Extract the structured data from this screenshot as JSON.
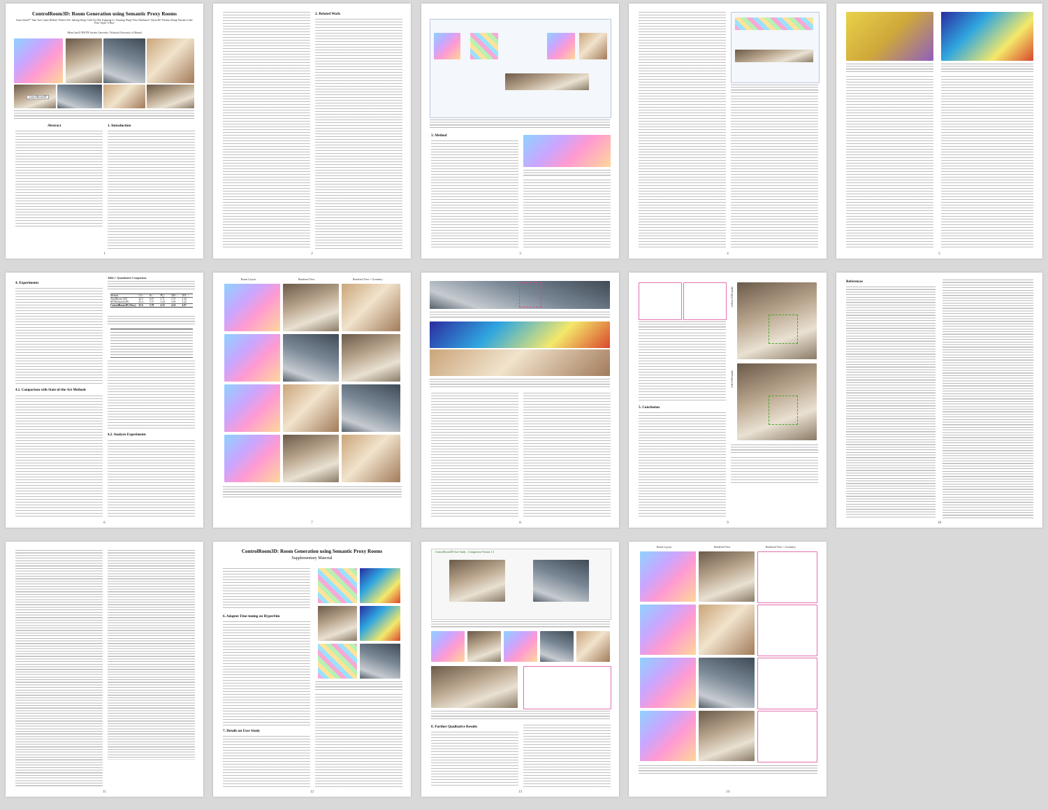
{
  "paper": {
    "title": "ControlRoom3D: Room Generation using Semantic Proxy Rooms",
    "authors": "Jonas Schult¹²*  Sam Tsai¹  Lukas Höllein¹³  Bichen Wu¹  Jialiang Wang¹  Chih-Yao Ma¹  Kunpeng Li¹  Xiaofang Wang¹  Felix Wimbauer¹³  Zijian He¹  Peizhao Zhang¹  Bastian Leibe²  Peter Vajda¹  Ji Hou¹",
    "affiliations": "¹Meta GenAI   ²RWTH Aachen University   ³Technical University of Munich",
    "supp_title": "ControlRoom3D: Room Generation using Semantic Proxy Rooms",
    "supp_subtitle": "Supplementary Material"
  },
  "figures": {
    "teaser_badge": "ControlRoom3D",
    "results_col1": "Room Layout",
    "results_col2": "Rendered View",
    "results_col3": "Rendered View + Geometry",
    "supp_col1": "Room Layout",
    "supp_col2": "Rendered View",
    "supp_col3": "Rendered View + Geometry",
    "with_sam": "with SAM masks",
    "without_sam": "without SAM masks",
    "ui_title": "ControlRoom3D User Study – Comparison Version 1.3"
  },
  "headings": {
    "abstract": "Abstract",
    "intro": "1. Introduction",
    "related": "2. Related Work",
    "method": "3. Method",
    "experiments": "4. Experiments",
    "comparison": "4.1. Comparison with State-of-the-Art Methods",
    "analysis": "4.2. Analysis Experiments",
    "conclusion": "5. Conclusion",
    "references": "References",
    "adapter": "6. Adapter Fine-tuning on HyperSim",
    "user_study": "7. Details on User Study",
    "further": "8. Further Qualitative Results"
  },
  "table": {
    "caption": "Table 1. Quantitative Comparison.",
    "header": [
      "Method",
      "CS ↑",
      "IS ↑",
      "PQ ↑",
      "3DS ↑",
      "3DC ↑"
    ],
    "rows": [
      [
        "Text2Room [20]",
        "24.5",
        "6.07",
        "2.71",
        "2.73",
        "2.44"
      ],
      [
        "MVDiffusion [49]",
        "25.4",
        "5.37",
        "3.44",
        "3.39",
        "3.22"
      ],
      [
        "ControlRoom3D (Ours)",
        "25.6",
        "5.78",
        "4.35",
        "4.34",
        "4.07"
      ]
    ]
  },
  "page_numbers": [
    "1",
    "2",
    "3",
    "4",
    "5",
    "6",
    "7",
    "8",
    "9",
    "10",
    "11",
    "12",
    "13",
    "14"
  ]
}
